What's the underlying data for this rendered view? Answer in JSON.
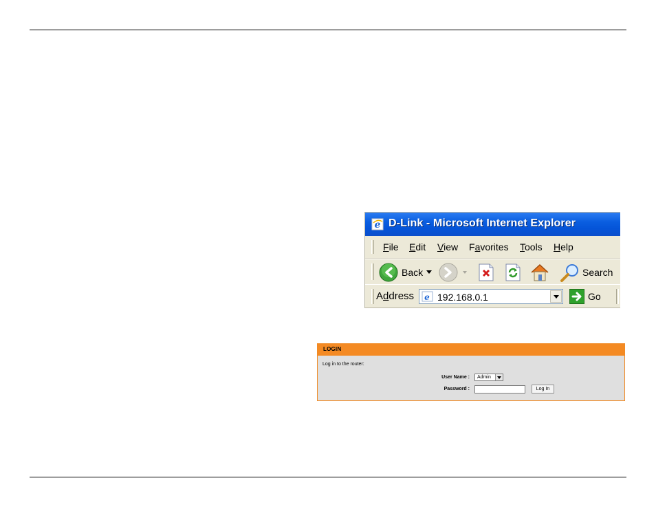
{
  "browser": {
    "window_title": "D-Link - Microsoft Internet Explorer",
    "menu": [
      {
        "accel": "F",
        "rest": "ile"
      },
      {
        "accel": "E",
        "rest": "dit"
      },
      {
        "accel": "V",
        "rest": "iew"
      },
      {
        "pre": "F",
        "accel": "a",
        "rest": "vorites"
      },
      {
        "accel": "T",
        "rest": "ools"
      },
      {
        "accel": "H",
        "rest": "elp"
      }
    ],
    "toolbar": {
      "back_label": "Back",
      "search_label": "Search"
    },
    "address": {
      "label_pre": "A",
      "label_accel": "d",
      "label_rest": "dress",
      "url": "192.168.0.1",
      "go_label": "Go"
    }
  },
  "login": {
    "header": "LOGIN",
    "intro": "Log in to the router:",
    "username_label": "User Name :",
    "username_value": "Admin",
    "password_label": "Password :",
    "password_value": "",
    "login_button": "Log In"
  },
  "colors": {
    "title_bar": "#0a5ee0",
    "toolbar_bg": "#ece9d8",
    "login_header": "#f48a23",
    "login_bg": "#dfdfdf"
  }
}
